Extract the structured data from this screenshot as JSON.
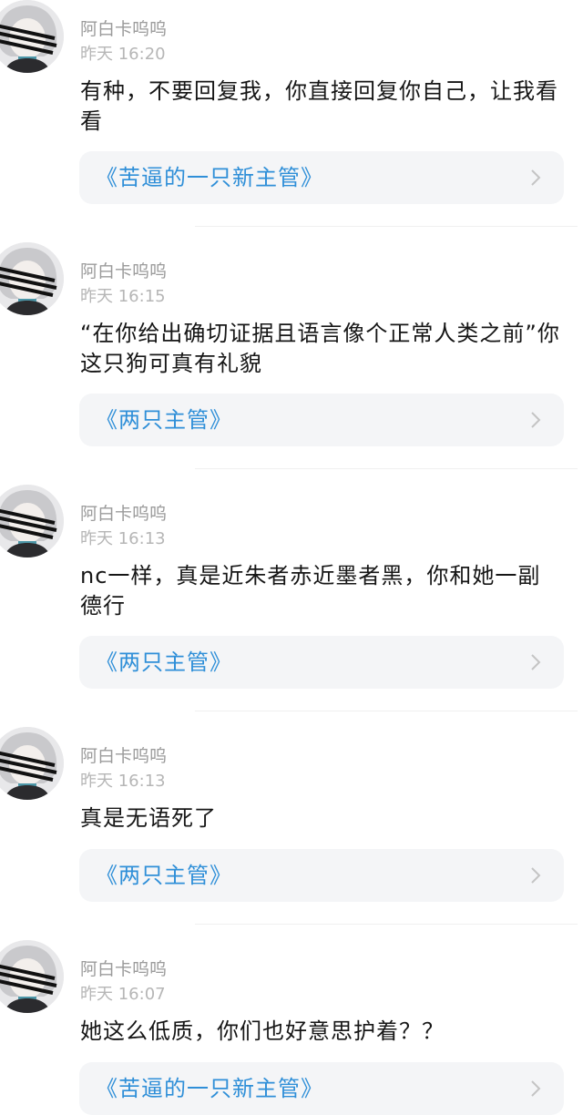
{
  "comments": [
    {
      "user": "阿白卡呜呜",
      "time": "昨天 16:20",
      "text": "有种，不要回复我，你直接回复你自己，让我看看",
      "card_title": "《苦逼的一只新主管》"
    },
    {
      "user": "阿白卡呜呜",
      "time": "昨天 16:15",
      "text": "“在你给出确切证据且语言像个正常人类之前”你这只狗可真有礼貌",
      "card_title": "《两只主管》"
    },
    {
      "user": "阿白卡呜呜",
      "time": "昨天 16:13",
      "text": "nc一样，真是近朱者赤近墨者黑，你和她一副德行",
      "card_title": "《两只主管》"
    },
    {
      "user": "阿白卡呜呜",
      "time": "昨天 16:13",
      "text": "真是无语死了",
      "card_title": "《两只主管》"
    },
    {
      "user": "阿白卡呜呜",
      "time": "昨天 16:07",
      "text": "她这么低质，你们也好意思护着？？",
      "card_title": "《苦逼的一只新主管》"
    }
  ],
  "icons": {
    "avatar": "user-avatar",
    "chevron": "chevron-right-icon"
  },
  "colors": {
    "link": "#2f8fd8",
    "card_bg": "#f4f5f7",
    "meta": "#9b9b9b"
  }
}
